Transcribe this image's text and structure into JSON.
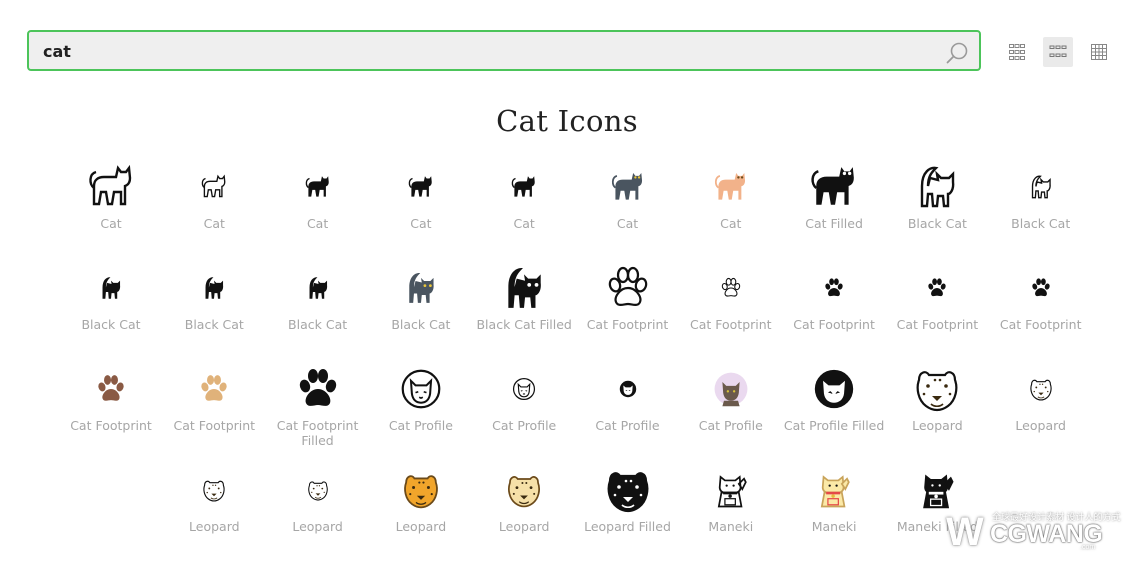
{
  "search": {
    "value": "cat"
  },
  "page_title": "Cat Icons",
  "icons": [
    {
      "label": "Cat",
      "icon": "cat-outline-large-icon"
    },
    {
      "label": "Cat",
      "icon": "cat-outline-small-icon"
    },
    {
      "label": "Cat",
      "icon": "cat-filled-small-icon"
    },
    {
      "label": "Cat",
      "icon": "cat-filled-small-icon"
    },
    {
      "label": "Cat",
      "icon": "cat-filled-small-icon"
    },
    {
      "label": "Cat",
      "icon": "cat-gray-color-icon"
    },
    {
      "label": "Cat",
      "icon": "cat-orange-color-icon"
    },
    {
      "label": "Cat Filled",
      "icon": "cat-filled-large-icon"
    },
    {
      "label": "Black Cat",
      "icon": "black-cat-outline-large-icon"
    },
    {
      "label": "Black Cat",
      "icon": "black-cat-outline-small-icon"
    },
    {
      "label": "Black Cat",
      "icon": "black-cat-small-icon"
    },
    {
      "label": "Black Cat",
      "icon": "black-cat-small-icon"
    },
    {
      "label": "Black Cat",
      "icon": "black-cat-small-icon"
    },
    {
      "label": "Black Cat",
      "icon": "black-cat-gray-color-icon"
    },
    {
      "label": "Black Cat Filled",
      "icon": "black-cat-filled-large-icon"
    },
    {
      "label": "Cat Footprint",
      "icon": "paw-outline-large-icon"
    },
    {
      "label": "Cat Footprint",
      "icon": "paw-outline-small-icon"
    },
    {
      "label": "Cat Footprint",
      "icon": "paw-filled-small-icon"
    },
    {
      "label": "Cat Footprint",
      "icon": "paw-filled-small-icon"
    },
    {
      "label": "Cat Footprint",
      "icon": "paw-filled-small-icon"
    },
    {
      "label": "Cat Footprint",
      "icon": "paw-brown-color-icon"
    },
    {
      "label": "Cat Footprint",
      "icon": "paw-tan-color-icon"
    },
    {
      "label": "Cat Footprint Filled",
      "icon": "paw-filled-large-icon"
    },
    {
      "label": "Cat Profile",
      "icon": "cat-profile-outline-large-icon"
    },
    {
      "label": "Cat Profile",
      "icon": "cat-profile-outline-small-icon"
    },
    {
      "label": "Cat Profile",
      "icon": "cat-profile-filled-small-icon"
    },
    {
      "label": "Cat Profile",
      "icon": "cat-profile-color-icon"
    },
    {
      "label": "Cat Profile Filled",
      "icon": "cat-profile-filled-large-icon"
    },
    {
      "label": "Leopard",
      "icon": "leopard-outline-large-icon"
    },
    {
      "label": "Leopard",
      "icon": "leopard-outline-small-icon"
    },
    {
      "label": "Leopard",
      "icon": "leopard-outline-small-icon"
    },
    {
      "label": "Leopard",
      "icon": "leopard-filled-small-icon"
    },
    {
      "label": "Leopard",
      "icon": "leopard-yellow-color-icon"
    },
    {
      "label": "Leopard",
      "icon": "leopard-cream-color-icon"
    },
    {
      "label": "Leopard Filled",
      "icon": "leopard-filled-large-icon"
    },
    {
      "label": "Maneki",
      "icon": "maneki-outline-icon"
    },
    {
      "label": "Maneki",
      "icon": "maneki-color-icon"
    },
    {
      "label": "Maneki Filled",
      "icon": "maneki-filled-icon"
    }
  ],
  "watermark": {
    "logo": "W",
    "chinese": "全球最好设计素材 设计人的方式",
    "name": "CGWANG",
    "domain": ".com"
  },
  "colors": {
    "search_border": "#4cc45a",
    "search_bg": "#efefef",
    "label": "#a6a6a6"
  }
}
